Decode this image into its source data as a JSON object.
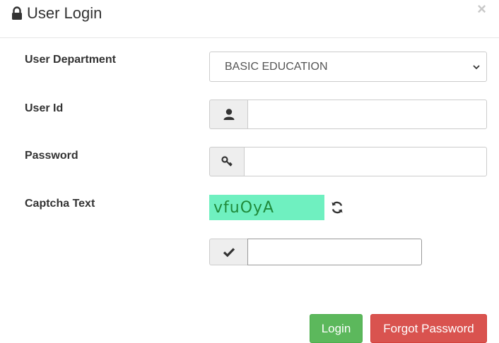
{
  "header": {
    "title": "User Login",
    "title_icon": "lock-icon",
    "close_label": "×"
  },
  "form": {
    "department": {
      "label": "User Department",
      "selected": "BASIC EDUCATION"
    },
    "user_id": {
      "label": "User Id",
      "value": "",
      "icon": "user-icon"
    },
    "password": {
      "label": "Password",
      "value": "",
      "icon": "key-icon"
    },
    "captcha": {
      "label": "Captcha Text",
      "code": "vfuOyA",
      "refresh_icon": "refresh-icon",
      "input_icon": "check-icon",
      "value": ""
    }
  },
  "buttons": {
    "login": "Login",
    "forgot": "Forgot Password"
  },
  "colors": {
    "captcha_bg": "#6ff0c0",
    "captcha_text": "#1f8a3a",
    "login_btn": "#5cb85c",
    "forgot_btn": "#d9534f"
  }
}
